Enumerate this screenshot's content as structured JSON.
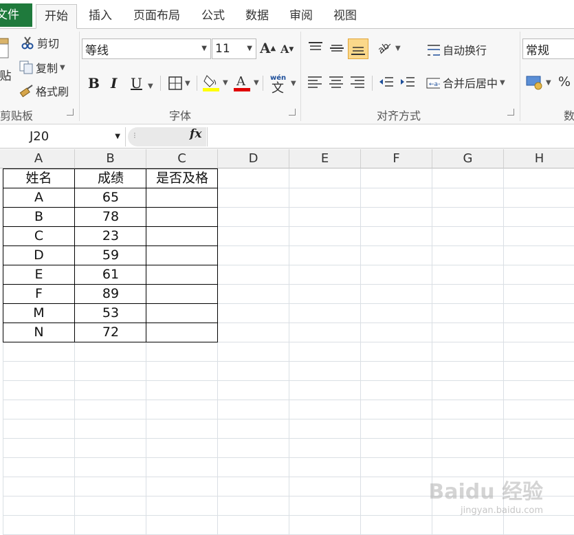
{
  "tabs": [
    "文件",
    "开始",
    "插入",
    "页面布局",
    "公式",
    "数据",
    "审阅",
    "视图"
  ],
  "active_tab": "开始",
  "clipboard": {
    "paste_label": "贴",
    "cut_label": "剪切",
    "copy_label": "复制",
    "format_painter_label": "格式刷",
    "group_label": "剪贴板"
  },
  "font": {
    "font_name": "等线",
    "font_size": "11",
    "bold": "B",
    "italic": "I",
    "underline": "U",
    "group_label": "字体",
    "fill_color": "#ffff00",
    "font_color": "#e00000"
  },
  "alignment": {
    "wrap_text_label": "自动换行",
    "merge_center_label": "合并后居中",
    "group_label": "对齐方式"
  },
  "number": {
    "format_value": "常规",
    "percent": "%",
    "group_label": "数"
  },
  "formula_bar": {
    "name_box": "J20",
    "fx_label": "fx",
    "formula": ""
  },
  "columns": [
    "A",
    "B",
    "C",
    "D",
    "E",
    "F",
    "G",
    "H"
  ],
  "sheet": {
    "headers": [
      "姓名",
      "成绩",
      "是否及格"
    ],
    "rows": [
      [
        "A",
        "65",
        ""
      ],
      [
        "B",
        "78",
        ""
      ],
      [
        "C",
        "23",
        ""
      ],
      [
        "D",
        "59",
        ""
      ],
      [
        "E",
        "61",
        ""
      ],
      [
        "F",
        "89",
        ""
      ],
      [
        "M",
        "53",
        ""
      ],
      [
        "N",
        "72",
        ""
      ]
    ]
  },
  "watermark": {
    "text": "Baidu 经验",
    "sub": "jingyan.baidu.com"
  }
}
